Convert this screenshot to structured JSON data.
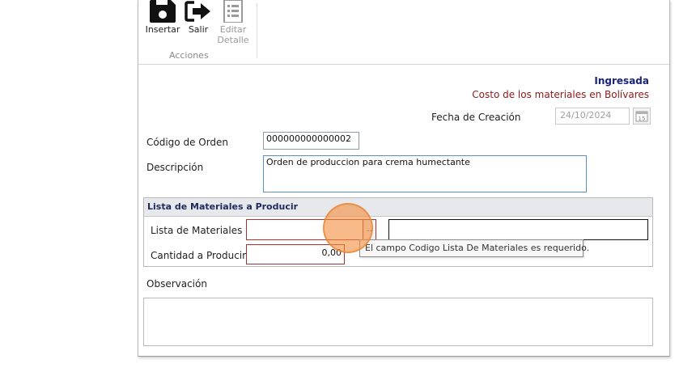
{
  "ribbon": {
    "insert_label": "Insertar",
    "exit_label": "Salir",
    "edit_detail_label": "Editar Detalle",
    "group_label": "Acciones",
    "icons": {
      "insert": "save-icon",
      "exit": "exit-arrow-icon",
      "edit_detail": "document-list-icon"
    }
  },
  "status": {
    "state": "Ingresada",
    "cost_note": "Costo de los materiales en Bolívares"
  },
  "form": {
    "created_date_label": "Fecha de Creación",
    "created_date_value": "24/10/2024",
    "order_code_label": "Código de Orden",
    "order_code_value": "000000000000002",
    "description_label": "Descripción",
    "description_value": "Orden de produccion para crema humectante",
    "observation_label": "Observación",
    "observation_value": ""
  },
  "materials_section": {
    "title": "Lista de Materiales a Producir",
    "bom_label": "Lista de Materiales",
    "bom_value": "",
    "bom_lookup_label": "..",
    "bom_name_value": "",
    "quantity_label": "Cantidad a Producir",
    "quantity_value": "0,00",
    "validation_tooltip": "El campo Codigo Lista De Materiales es requerido."
  },
  "colors": {
    "status_title": "#1a237e",
    "status_sub": "#8b1a1a",
    "error_border": "#a83232",
    "click_highlight": "#f58c3c"
  }
}
